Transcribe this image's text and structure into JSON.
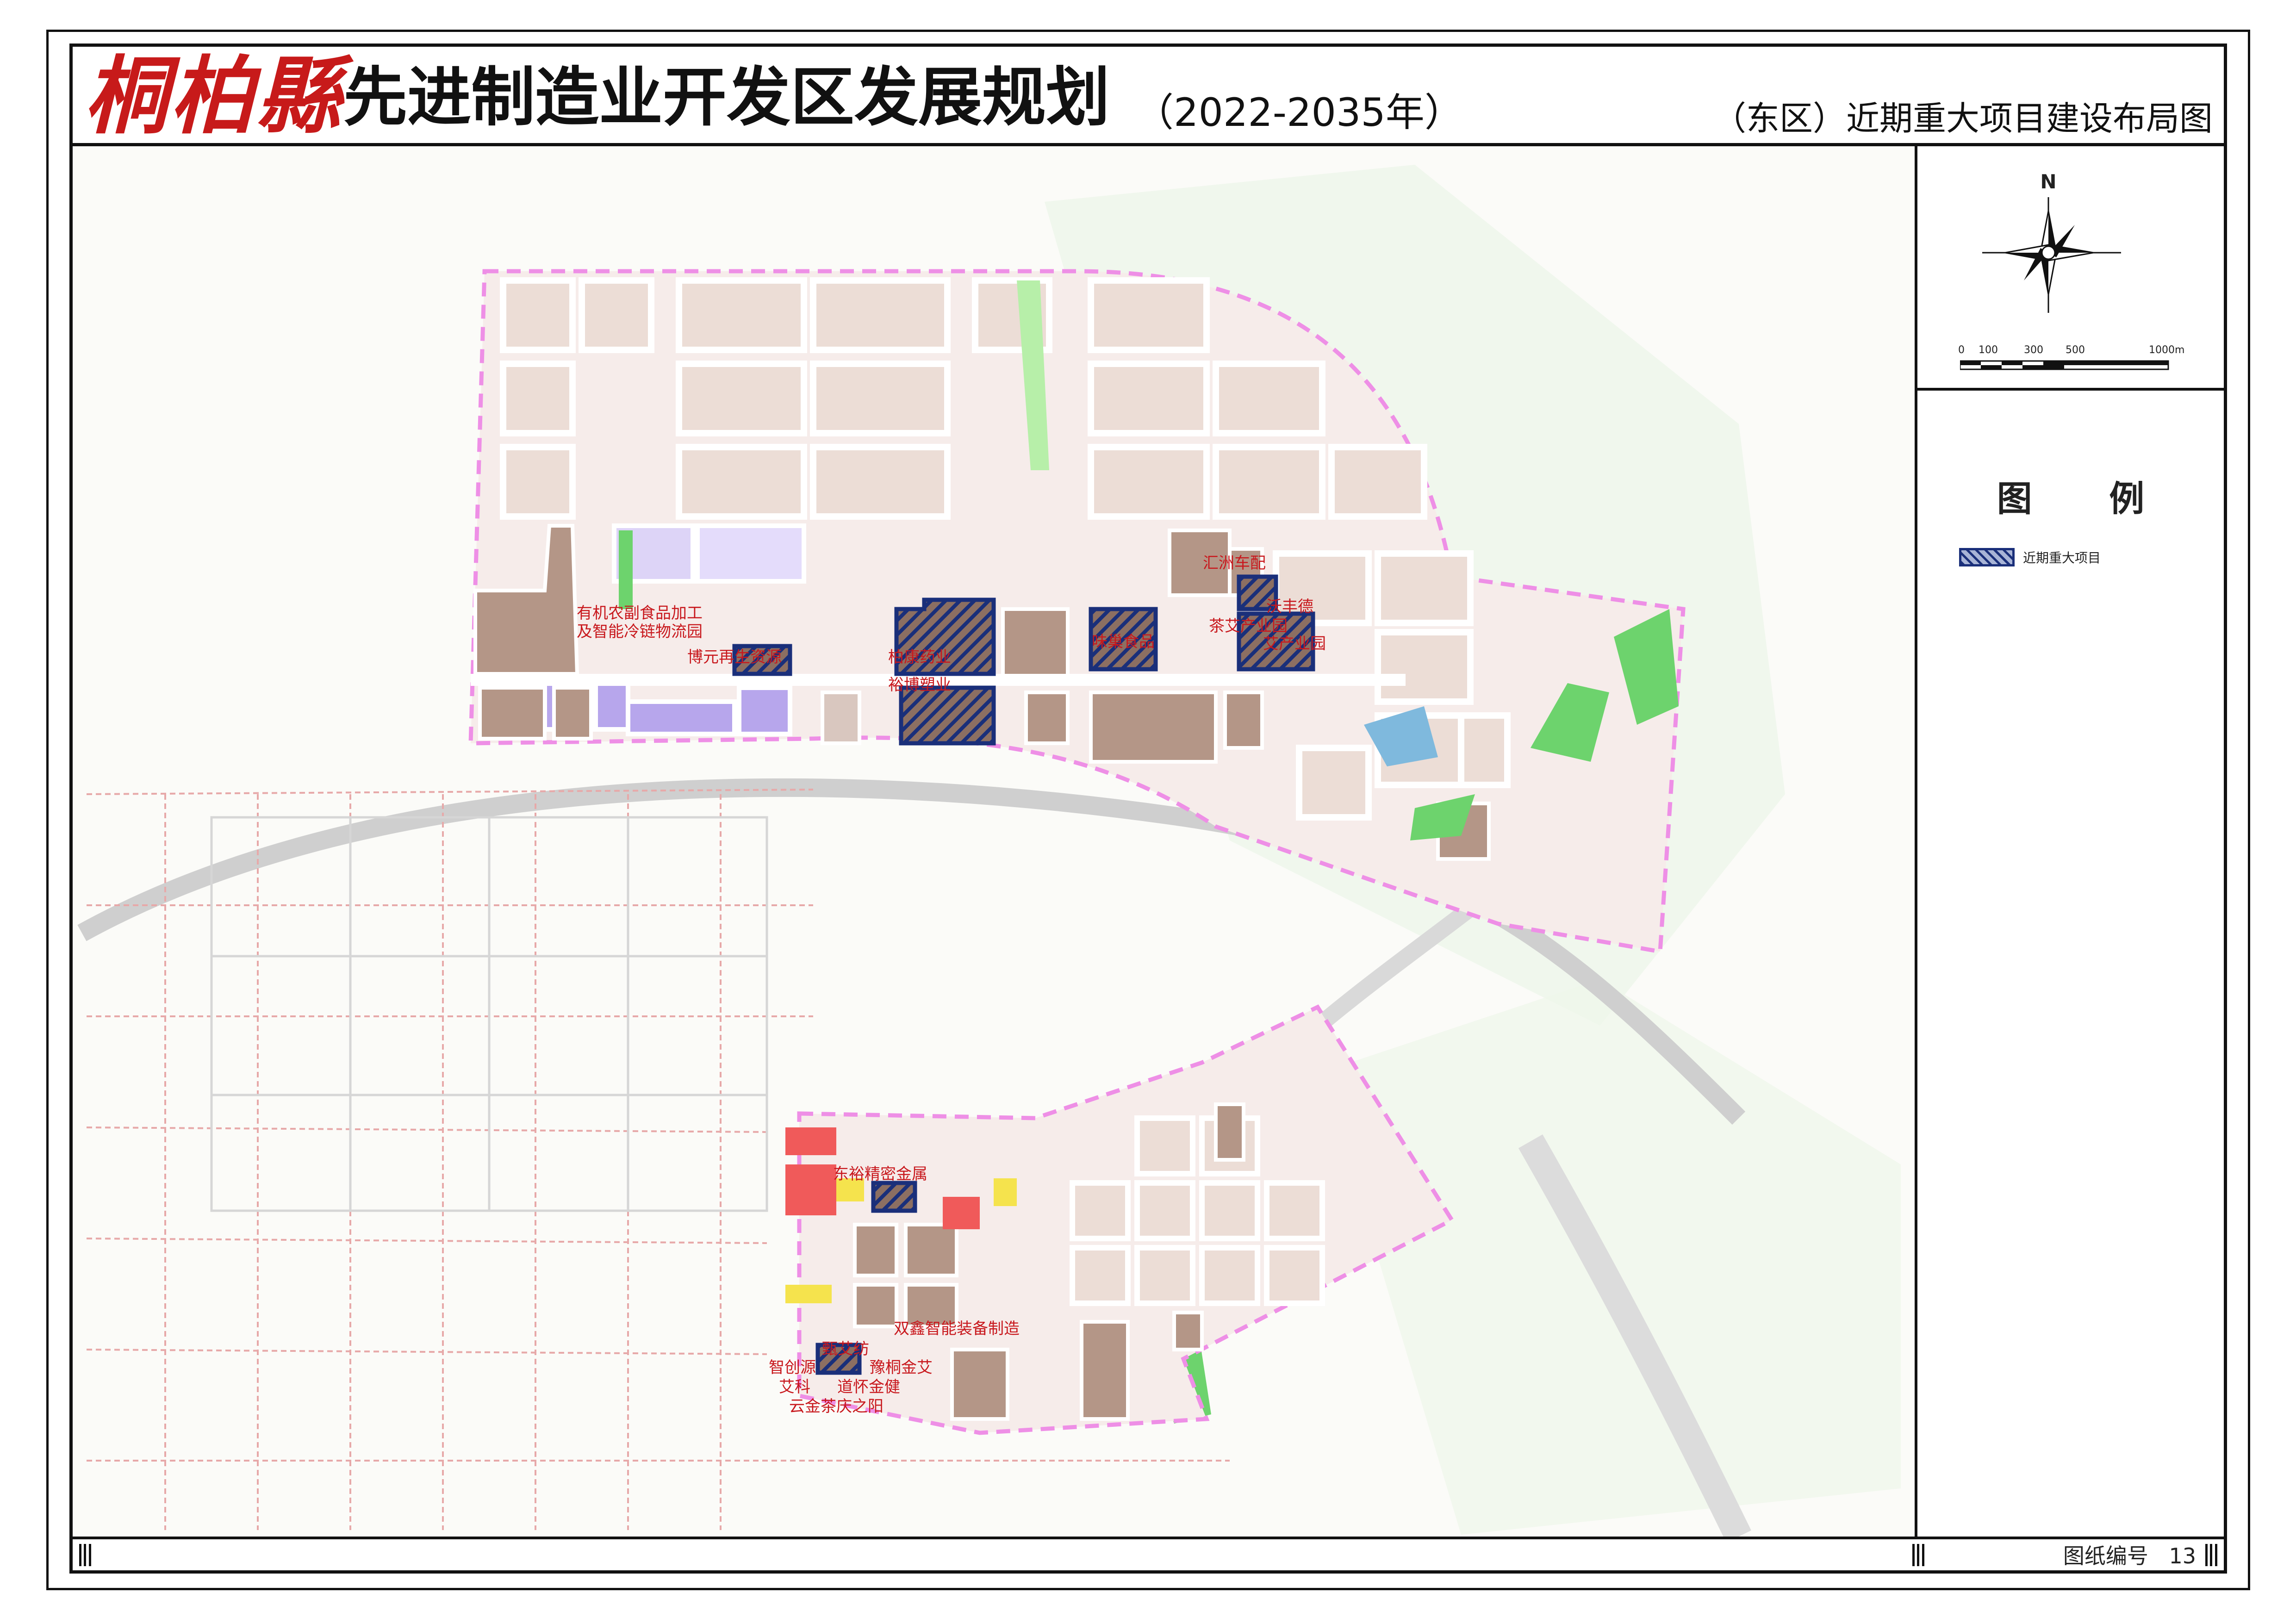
{
  "title": {
    "county_logo": "桐柏縣",
    "main": "先进制造业开发区发展规划",
    "years": "（2022-2035年）",
    "subtitle": "（东区）近期重大项目建设布局图"
  },
  "compass": {
    "north_label": "N",
    "scale_labels": [
      "0",
      "100",
      "300",
      "500",
      "1000m"
    ]
  },
  "legend": {
    "title": "图 例",
    "items": [
      {
        "label": "近期重大项目",
        "swatch": "hatched-blue",
        "color": "#1a2f7a"
      }
    ]
  },
  "sheet_number": {
    "label": "图纸编号",
    "value": "13"
  },
  "projects": [
    "有机农副食品加工",
    "及智能冷链物流园",
    "博元再生资源",
    "柏康药业",
    "裕博塑业",
    "味巢食品",
    "汇洲车配",
    "沃丰德",
    "茶艾产业园",
    "艾产业园",
    "东裕精密金属",
    "双鑫智能装备制造",
    "甄艾纺",
    "智创源",
    "豫桐金艾",
    "艾科",
    "道怀金健",
    "云金茶庆之阳"
  ],
  "colors": {
    "industrial": "#b49687",
    "industrial_light": "#ecddd6",
    "logistics": "#b7a6ec",
    "green": "#6dd36d",
    "water": "#7fb9dd",
    "commercial": "#f05a5a",
    "boundary": "#ee8fe6",
    "project_outline": "#1a2f7a",
    "label_red": "#c8181d"
  }
}
